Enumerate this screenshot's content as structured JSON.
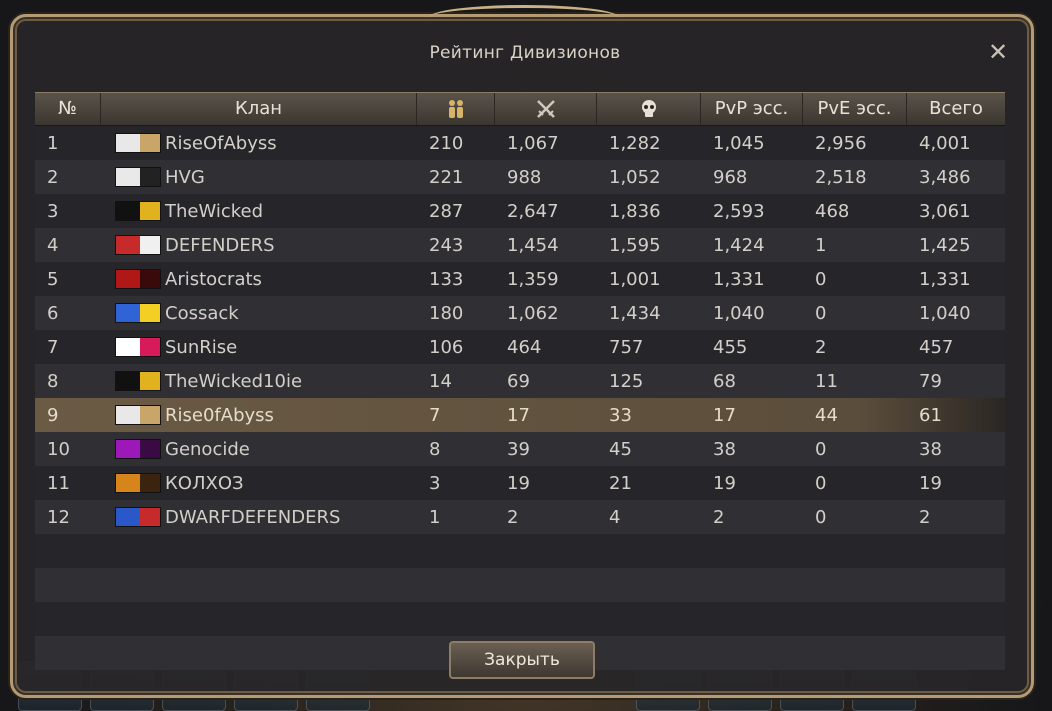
{
  "window": {
    "title": "Рейтинг Дивизионов",
    "close_icon": "close-icon",
    "close_button_label": "Закрыть"
  },
  "table": {
    "headers": {
      "rank": "№",
      "clan": "Клан",
      "members_icon": "members-icon",
      "kills_icon": "crossed-swords-icon",
      "deaths_icon": "skull-icon",
      "pvp": "PvP эсс.",
      "pve": "PvE эсс.",
      "total": "Всего"
    },
    "rows": [
      {
        "rank": "1",
        "clan": "RiseOfAbyss",
        "members": "210",
        "kills": "1,067",
        "deaths": "1,282",
        "pvp": "1,045",
        "pve": "2,956",
        "total": "4,001",
        "crest": [
          "#e8e8e8",
          "#c9a56a"
        ]
      },
      {
        "rank": "2",
        "clan": "HVG",
        "members": "221",
        "kills": "988",
        "deaths": "1,052",
        "pvp": "968",
        "pve": "2,518",
        "total": "3,486",
        "crest": [
          "#e9e9e9",
          "#222222"
        ]
      },
      {
        "rank": "3",
        "clan": "TheWicked",
        "members": "287",
        "kills": "2,647",
        "deaths": "1,836",
        "pvp": "2,593",
        "pve": "468",
        "total": "3,061",
        "crest": [
          "#111111",
          "#e0b21e"
        ]
      },
      {
        "rank": "4",
        "clan": "DEFENDERS",
        "members": "243",
        "kills": "1,454",
        "deaths": "1,595",
        "pvp": "1,424",
        "pve": "1",
        "total": "1,425",
        "crest": [
          "#c62a2a",
          "#f0f0f0"
        ]
      },
      {
        "rank": "5",
        "clan": "Aristocrats",
        "members": "133",
        "kills": "1,359",
        "deaths": "1,001",
        "pvp": "1,331",
        "pve": "0",
        "total": "1,331",
        "crest": [
          "#b01818",
          "#3a0a0a"
        ]
      },
      {
        "rank": "6",
        "clan": "Cossack",
        "members": "180",
        "kills": "1,062",
        "deaths": "1,434",
        "pvp": "1,040",
        "pve": "0",
        "total": "1,040",
        "crest": [
          "#2f63d6",
          "#f2cf22"
        ]
      },
      {
        "rank": "7",
        "clan": "SunRise",
        "members": "106",
        "kills": "464",
        "deaths": "757",
        "pvp": "455",
        "pve": "2",
        "total": "457",
        "crest": [
          "#ffffff",
          "#d61a5a"
        ]
      },
      {
        "rank": "8",
        "clan": "TheWicked10ie",
        "members": "14",
        "kills": "69",
        "deaths": "125",
        "pvp": "68",
        "pve": "11",
        "total": "79",
        "crest": [
          "#111111",
          "#e0b21e"
        ]
      },
      {
        "rank": "9",
        "clan": "Rise0fAbyss",
        "members": "7",
        "kills": "17",
        "deaths": "33",
        "pvp": "17",
        "pve": "44",
        "total": "61",
        "crest": [
          "#e8e8e8",
          "#c9a56a"
        ],
        "selected": true
      },
      {
        "rank": "10",
        "clan": "Genocide",
        "members": "8",
        "kills": "39",
        "deaths": "45",
        "pvp": "38",
        "pve": "0",
        "total": "38",
        "crest": [
          "#9c18b8",
          "#3a0a44"
        ]
      },
      {
        "rank": "11",
        "clan": "КОЛХОЗ",
        "members": "3",
        "kills": "19",
        "deaths": "21",
        "pvp": "19",
        "pve": "0",
        "total": "19",
        "crest": [
          "#d6851a",
          "#3a2410"
        ]
      },
      {
        "rank": "12",
        "clan": "DWARFDEFENDERS",
        "members": "1",
        "kills": "2",
        "deaths": "4",
        "pvp": "2",
        "pve": "0",
        "total": "2",
        "crest": [
          "#2a58c8",
          "#c62a2a"
        ]
      }
    ]
  },
  "colors": {
    "frame": "#b39b73",
    "selected_row": "#6b5b45",
    "text": "#d3cfc8"
  }
}
